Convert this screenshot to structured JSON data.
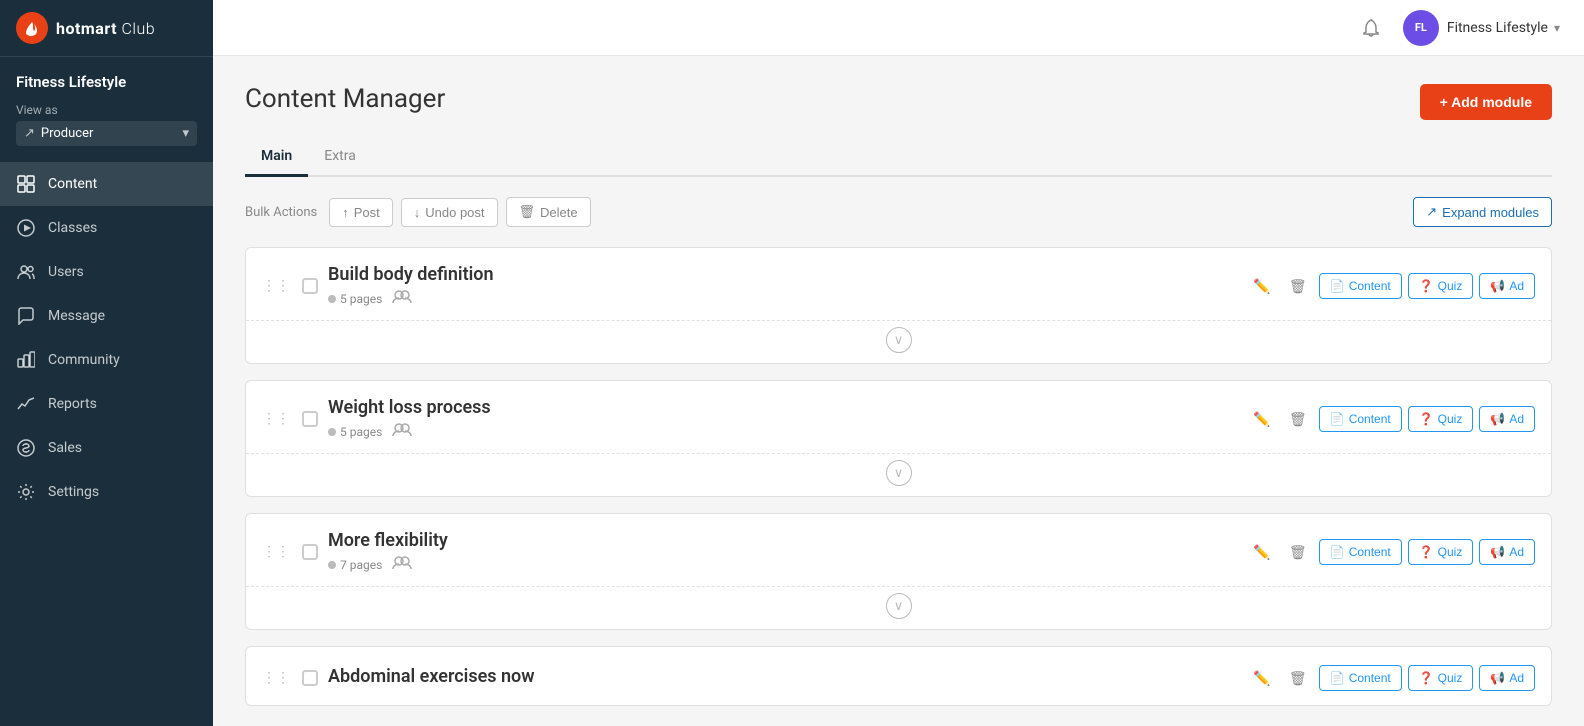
{
  "app": {
    "logo_text": "hotmart",
    "logo_sub": "Club"
  },
  "sidebar": {
    "product_name": "Fitness Lifestyle",
    "view_as_label": "View as",
    "producer_label": "Producer",
    "nav_items": [
      {
        "id": "content",
        "label": "Content",
        "active": true,
        "icon": "content-icon"
      },
      {
        "id": "classes",
        "label": "Classes",
        "active": false,
        "icon": "classes-icon"
      },
      {
        "id": "users",
        "label": "Users",
        "active": false,
        "icon": "users-icon"
      },
      {
        "id": "message",
        "label": "Message",
        "active": false,
        "icon": "message-icon"
      },
      {
        "id": "community",
        "label": "Community",
        "active": false,
        "icon": "community-icon"
      },
      {
        "id": "reports",
        "label": "Reports",
        "active": false,
        "icon": "reports-icon"
      },
      {
        "id": "sales",
        "label": "Sales",
        "active": false,
        "icon": "sales-icon"
      },
      {
        "id": "settings",
        "label": "Settings",
        "active": false,
        "icon": "settings-icon"
      }
    ]
  },
  "topbar": {
    "avatar_text": "FL",
    "username": "Fitness Lifestyle"
  },
  "page": {
    "title": "Content Manager",
    "add_module_label": "+ Add module",
    "tabs": [
      {
        "label": "Main",
        "active": true
      },
      {
        "label": "Extra",
        "active": false
      }
    ],
    "bulk_actions_label": "Bulk Actions",
    "post_btn": "Post",
    "undo_post_btn": "Undo post",
    "delete_btn": "Delete",
    "expand_modules_btn": "Expand modules"
  },
  "modules": [
    {
      "title": "Build body definition",
      "pages": "5 pages",
      "page_count": "5"
    },
    {
      "title": "Weight loss process",
      "pages": "5 pages",
      "page_count": "5"
    },
    {
      "title": "More flexibility",
      "pages": "7 pages",
      "page_count": "7"
    },
    {
      "title": "Abdominal exercises now",
      "pages": "",
      "page_count": ""
    }
  ],
  "module_actions": {
    "content_btn": "Content",
    "quiz_btn": "Quiz",
    "ad_btn": "Ad"
  }
}
